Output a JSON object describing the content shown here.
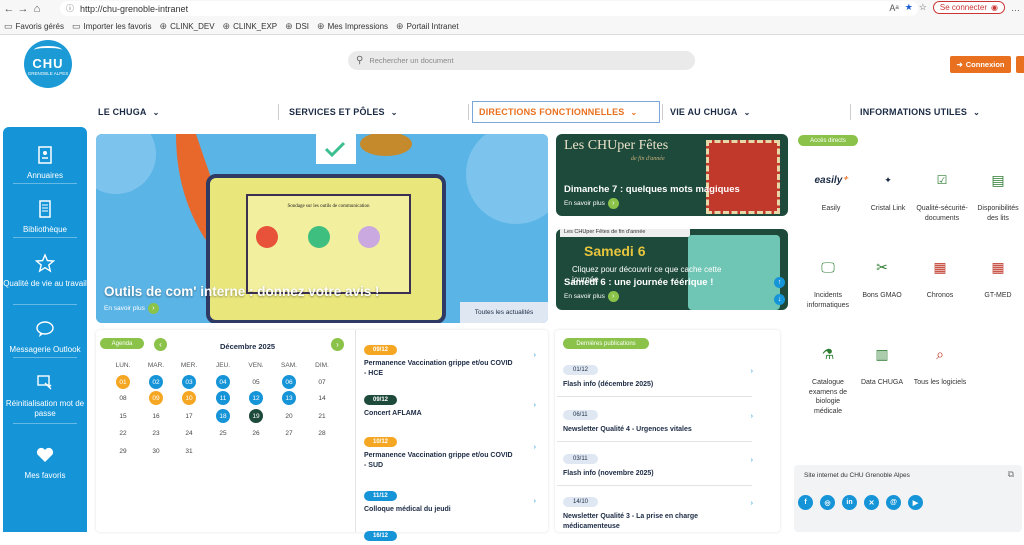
{
  "browser": {
    "url": "http://chu-grenoble-intranet",
    "signin": "Se connecter",
    "favorites": [
      {
        "label": "Favoris gérés",
        "icon": "folder-icon"
      },
      {
        "label": "Importer les favoris",
        "icon": "folder-icon"
      },
      {
        "label": "CLINK_DEV",
        "icon": "globe-icon"
      },
      {
        "label": "CLINK_EXP",
        "icon": "globe-icon"
      },
      {
        "label": "DSI",
        "icon": "globe-icon"
      },
      {
        "label": "Mes Impressions",
        "icon": "globe-icon"
      },
      {
        "label": "Portail Intranet",
        "icon": "globe-icon"
      }
    ]
  },
  "header": {
    "logo_main": "CHU",
    "logo_sub": "GRENOBLE ALPES",
    "search_placeholder": "Rechercher un document",
    "login_label": "Connexion"
  },
  "menu": [
    {
      "label": "LE CHUGA"
    },
    {
      "label": "SERVICES ET PÔLES"
    },
    {
      "label": "DIRECTIONS FONCTIONNELLES"
    },
    {
      "label": "VIE AU CHUGA"
    },
    {
      "label": "INFORMATIONS UTILES"
    }
  ],
  "sidebar": [
    {
      "label": "Annuaires",
      "icon": "address-book-icon"
    },
    {
      "label": "Bibliothèque",
      "icon": "book-icon"
    },
    {
      "label": "Qualité de vie au travail",
      "icon": "star-icon"
    },
    {
      "label": "Messagerie Outlook",
      "icon": "chat-icon"
    },
    {
      "label": "Réinitialisation mot de passe",
      "icon": "key-icon"
    },
    {
      "label": "Mes favoris",
      "icon": "heart-icon"
    }
  ],
  "hero": {
    "board_text": "Sondage sur les outils de communication",
    "title": "Outils de com' interne : donnez votre avis !",
    "more": "En savoir plus",
    "all_news": "Toutes les actualités"
  },
  "cards": [
    {
      "header": "Les CHUper Fêtes",
      "subheader": "de fin d'année",
      "title": "Dimanche 7 : quelques mots magiques",
      "more": "En savoir plus"
    },
    {
      "header": "Les CHUper Fêtes de fin d'année",
      "big": "Samedi 6",
      "body": "Cliquez pour découvrir ce que cache cette journée",
      "title": "Samedi 6 : une journée féérique !",
      "more": "En savoir plus"
    }
  ],
  "agenda": {
    "label": "Agenda",
    "month": "Décembre 2025",
    "weekdays": [
      "LUN.",
      "MAR.",
      "MER.",
      "JEU.",
      "VEN.",
      "SAM.",
      "DIM."
    ],
    "weeks": [
      [
        "01",
        "02",
        "03",
        "04",
        "05",
        "06",
        "07"
      ],
      [
        "08",
        "09",
        "10",
        "11",
        "12",
        "13",
        "14"
      ],
      [
        "15",
        "16",
        "17",
        "18",
        "19",
        "20",
        "21"
      ],
      [
        "22",
        "23",
        "24",
        "25",
        "26",
        "27",
        "28"
      ],
      [
        "29",
        "30",
        "31",
        "",
        "",
        "",
        ""
      ]
    ],
    "events": [
      {
        "date": "09/12",
        "title": "Permanence Vaccination grippe et/ou COVID - HCE"
      },
      {
        "date": "09/12",
        "title": "Concert AFLAMA"
      },
      {
        "date": "10/12",
        "title": "Permanence Vaccination grippe et/ou COVID - SUD"
      },
      {
        "date": "11/12",
        "title": "Colloque médical du jeudi"
      },
      {
        "date": "16/12",
        "title": ""
      }
    ]
  },
  "publications": {
    "label": "Dernières publications",
    "items": [
      {
        "date": "01/12",
        "title": "Flash info (décembre 2025)"
      },
      {
        "date": "06/11",
        "title": "Newsletter Qualité 4 - Urgences vitales"
      },
      {
        "date": "03/11",
        "title": "Flash info (novembre 2025)"
      },
      {
        "date": "14/10",
        "title": "Newsletter Qualité 3 - La prise en charge médicamenteuse"
      }
    ]
  },
  "direct_access": {
    "label": "Accès directs",
    "items": [
      {
        "label": "Easily",
        "icon": "easily-logo"
      },
      {
        "label": "Cristal Link",
        "icon": "cristal-link-logo"
      },
      {
        "label": "Qualité-sécurité-documents",
        "icon": "quality-icon"
      },
      {
        "label": "Disponibilités des lits",
        "icon": "document-icon"
      },
      {
        "label": "Incidents informatiques",
        "icon": "monitor-icon"
      },
      {
        "label": "Bons GMAO",
        "icon": "tools-icon"
      },
      {
        "label": "Chronos",
        "icon": "calendar-icon"
      },
      {
        "label": "GT-MED",
        "icon": "calendar-icon"
      },
      {
        "label": "Catalogue examens de biologie médicale",
        "icon": "lab-icon"
      },
      {
        "label": "Data CHUGA",
        "icon": "chart-icon"
      },
      {
        "label": "Tous les logiciels",
        "icon": "search-doc-icon"
      }
    ]
  },
  "site": {
    "label": "Site internet du CHU Grenoble Alpes",
    "socials": [
      "f",
      "◎",
      "in",
      "✕",
      "@",
      "▶"
    ]
  }
}
